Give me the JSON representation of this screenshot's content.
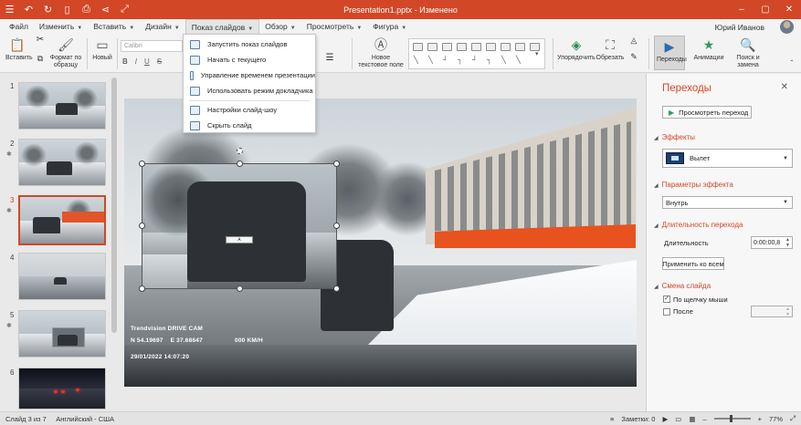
{
  "title": "Presentation1.pptx - Изменено",
  "menu": [
    {
      "label": "Файл"
    },
    {
      "label": "Изменить"
    },
    {
      "label": "Вставить"
    },
    {
      "label": "Дизайн"
    },
    {
      "label": "Показ слайдов"
    },
    {
      "label": "Обзор"
    },
    {
      "label": "Просмотреть"
    },
    {
      "label": "Фигура"
    }
  ],
  "user": {
    "name": "Юрий Иванов"
  },
  "ribbon": {
    "paste": "Вставить",
    "format_painter": "Формат по образцу",
    "new": "Новый",
    "font_placeholder": "Calibri",
    "bold": "B",
    "italic": "I",
    "underline": "U",
    "strike": "S",
    "new_textbox": "Новое текстовое поле",
    "arrange": "Упорядочить",
    "crop": "Обрезать",
    "transitions": "Переходы",
    "animations": "Анимации",
    "find_replace": "Поиск и замена"
  },
  "dropdown": {
    "items": [
      {
        "label": "Запустить показ слайдов"
      },
      {
        "label": "Начать с текущего"
      },
      {
        "label": "Управление временем презентации"
      },
      {
        "label": "Использовать режим докладчика"
      },
      {
        "label": "Настройки слайд-шоу"
      },
      {
        "label": "Скрыть слайд"
      }
    ]
  },
  "thumbnails": [
    {
      "num": "1"
    },
    {
      "num": "2"
    },
    {
      "num": "3"
    },
    {
      "num": "4"
    },
    {
      "num": "5"
    },
    {
      "num": "6"
    }
  ],
  "slide": {
    "cam_brand": "Trendvision DRIVE CAM",
    "coords": "N 54.19697    E 37.68647",
    "speed": "000 KM/H",
    "timestamp": "29/01/2022 14:07:20"
  },
  "pane": {
    "title": "Переходы",
    "preview": "Просмотреть переход",
    "effects": "Эффекты",
    "effect_value": "Вылет",
    "params": "Параметры эффекта",
    "params_value": "Внутрь",
    "duration_section": "Длительность перехода",
    "duration_label": "Длительность",
    "duration_value": "0:00:00,8",
    "apply_all": "Применить ко всем",
    "advance_section": "Смена слайда",
    "on_click": "По щелчку мыши",
    "after": "После"
  },
  "status": {
    "slide_info": "Слайд 3 из 7",
    "language": "Английский - США",
    "notes": "Заметки: 0",
    "zoom": "77%"
  },
  "colors": {
    "accent": "#d24726"
  }
}
